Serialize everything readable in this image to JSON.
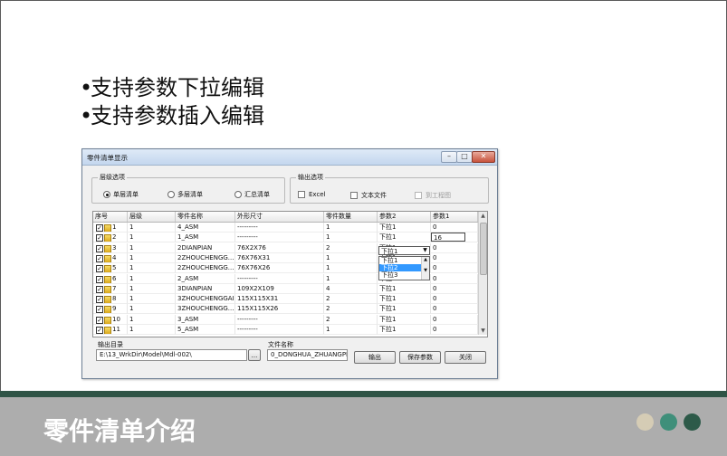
{
  "slide": {
    "bullets": [
      "支持参数下拉编辑",
      "支持参数插入编辑"
    ],
    "footer_title": "零件清单介绍",
    "colors": {
      "band": "#adadad",
      "band_line": "#2f5446",
      "dots": [
        "#d5ccb5",
        "#3f8f7a",
        "#2d5a49"
      ]
    }
  },
  "dialog": {
    "title": "零件清单显示",
    "window_buttons": [
      "minimize-icon",
      "maximize-icon",
      "close-icon"
    ],
    "level_group": {
      "legend": "层级选项",
      "options": [
        "单层清单",
        "多层清单",
        "汇总清单"
      ],
      "selected": 0
    },
    "output_group": {
      "legend": "输出选项",
      "options": [
        "Excel",
        "文本文件",
        "到工程图"
      ]
    },
    "table": {
      "columns": [
        "序号",
        "层级",
        "零件名称",
        "外形尺寸",
        "零件数量",
        "参数2",
        "参数1"
      ],
      "rows": [
        [
          "1",
          "1",
          "4_ASM",
          "---------",
          "1",
          "下拉1",
          "0"
        ],
        [
          "2",
          "1",
          "1_ASM",
          "---------",
          "1",
          "下拉1",
          "16"
        ],
        [
          "3",
          "1",
          "2DIANPIAN",
          "76X2X76",
          "2",
          "下拉1",
          "0"
        ],
        [
          "4",
          "1",
          "2ZHOUCHENGG...",
          "76X76X31",
          "1",
          "下拉1",
          "0"
        ],
        [
          "5",
          "1",
          "2ZHOUCHENGG...",
          "76X76X26",
          "1",
          "下拉2",
          "0"
        ],
        [
          "6",
          "1",
          "2_ASM",
          "---------",
          "1",
          "下拉3",
          "0"
        ],
        [
          "7",
          "1",
          "3DIANPIAN",
          "109X2X109",
          "4",
          "下拉1",
          "0"
        ],
        [
          "8",
          "1",
          "3ZHOUCHENGGAI",
          "115X115X31",
          "2",
          "下拉1",
          "0"
        ],
        [
          "9",
          "1",
          "3ZHOUCHENGG...",
          "115X115X26",
          "2",
          "下拉1",
          "0"
        ],
        [
          "10",
          "1",
          "3_ASM",
          "---------",
          "2",
          "下拉1",
          "0"
        ],
        [
          "11",
          "1",
          "5_ASM",
          "---------",
          "1",
          "下拉1",
          "0"
        ]
      ],
      "combo_value": "下拉1",
      "dropdown_options": [
        "下拉1",
        "下拉2",
        "下拉3"
      ],
      "dropdown_selected": 1,
      "edit_value": "16"
    },
    "output_dir_label": "输出目录",
    "output_dir_value": "E:\\13_WrkDir\\Model\\Mdl-002\\",
    "browse_label": "...",
    "file_name_label": "文件名称",
    "file_name_value": "0_DONGHUA_ZHUANGPEI",
    "buttons": {
      "output": "输出",
      "save_params": "保存参数",
      "close": "关闭"
    }
  }
}
